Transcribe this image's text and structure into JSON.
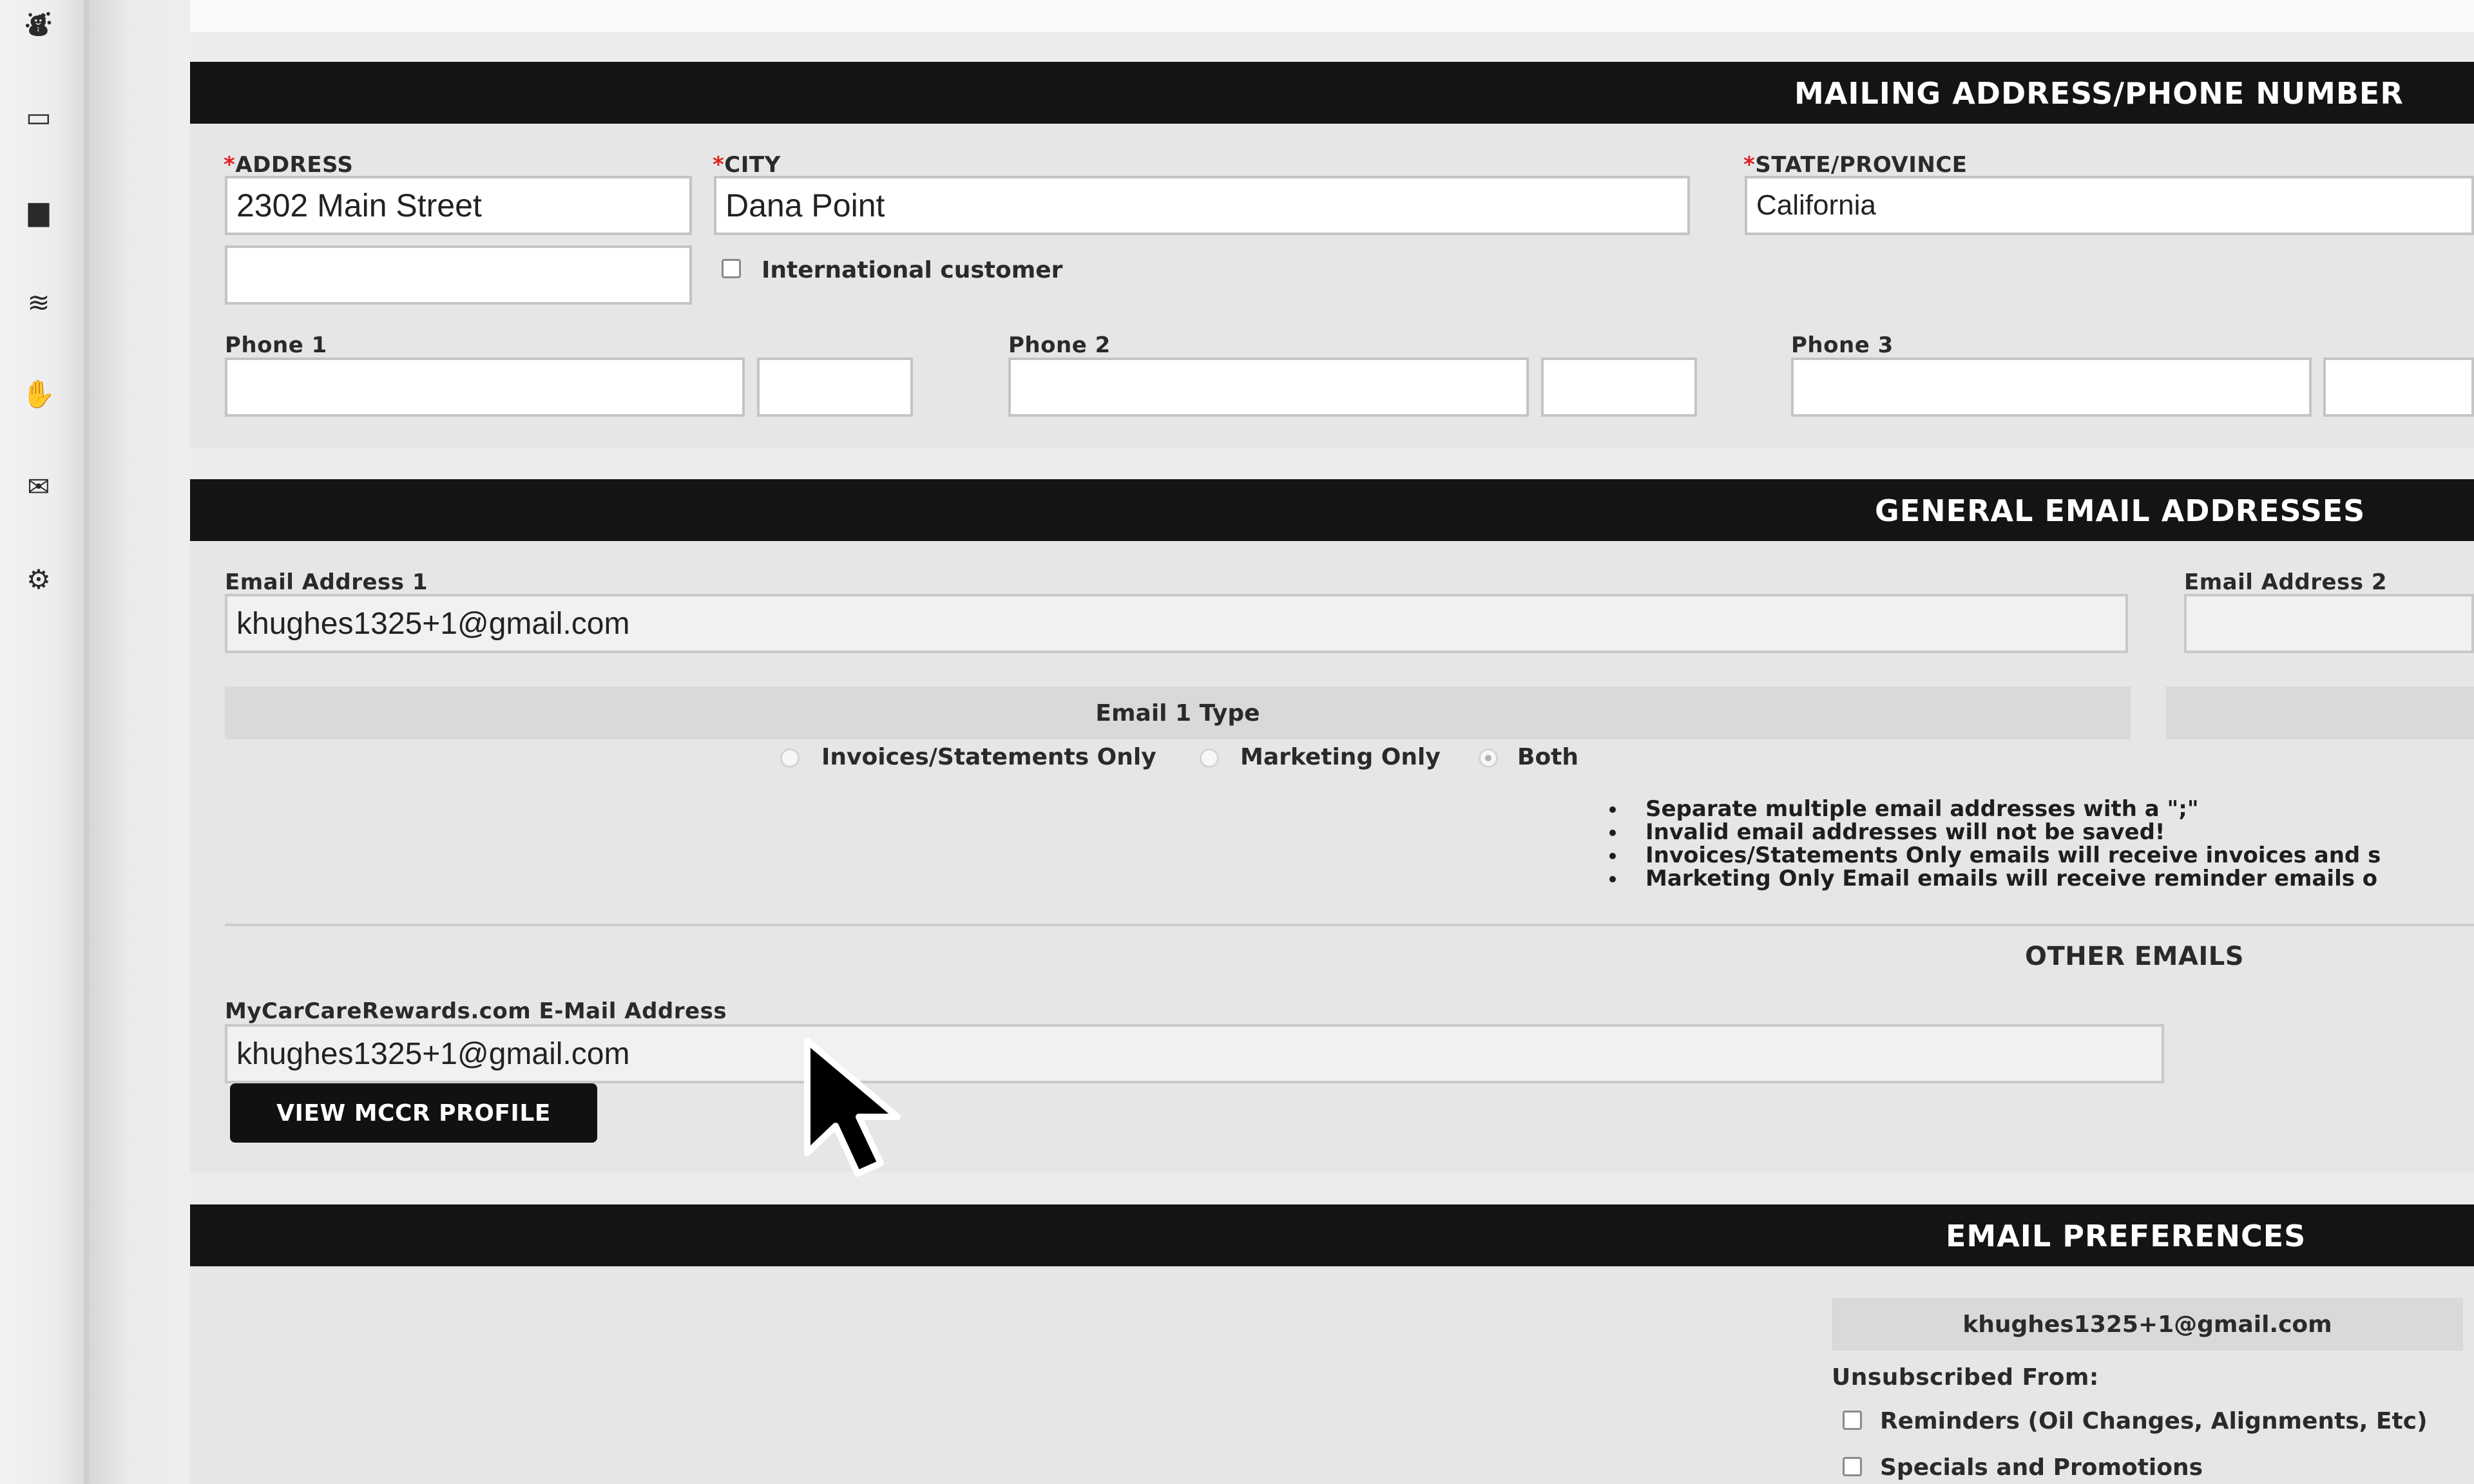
{
  "sidebar": {
    "items": [
      {
        "icon": "users-icon",
        "glyph": "⛇"
      },
      {
        "icon": "card-icon",
        "glyph": "▭"
      },
      {
        "icon": "document-icon",
        "glyph": "▆"
      },
      {
        "icon": "chart-icon",
        "glyph": "≋"
      },
      {
        "icon": "hand-icon",
        "glyph": "✋"
      },
      {
        "icon": "chat-icon",
        "glyph": "✉"
      },
      {
        "icon": "gear-icon",
        "glyph": "⚙"
      }
    ]
  },
  "mailing": {
    "title": "MAILING ADDRESS/PHONE NUMBER",
    "address_label": "ADDRESS",
    "address_value": "2302 Main Street",
    "address2_value": "",
    "city_label": "CITY",
    "city_value": "Dana Point",
    "intl_label": "International customer",
    "state_label": "STATE/PROVINCE",
    "state_value": "California",
    "phone1_label": "Phone 1",
    "phone2_label": "Phone 2",
    "phone3_label": "Phone 3"
  },
  "general_email": {
    "title": "GENERAL EMAIL ADDRESSES",
    "email1_label": "Email Address 1",
    "email1_value": "khughes1325+1@gmail.com",
    "email2_label": "Email Address 2",
    "email2_value": "",
    "type_label": "Email 1 Type",
    "options": [
      "Invoices/Statements Only",
      "Marketing Only",
      "Both"
    ],
    "selected_option": "Both",
    "notes": [
      "Separate multiple email addresses with a \";\"",
      "Invalid email addresses will not be saved!",
      "Invoices/Statements Only emails will receive invoices and s",
      "Marketing Only Email emails will receive reminder emails o"
    ],
    "other_emails_label": "OTHER EMAILS",
    "mccr_label": "MyCarCareRewards.com E-Mail Address",
    "mccr_value": "khughes1325+1@gmail.com",
    "view_button": "VIEW MCCR PROFILE"
  },
  "preferences": {
    "title": "EMAIL PREFERENCES",
    "email": "khughes1325+1@gmail.com",
    "unsub_label": "Unsubscribed From:",
    "items": [
      "Reminders (Oil Changes, Alignments, Etc)",
      "Specials and Promotions"
    ]
  },
  "colors": {
    "header_bg": "#141414",
    "panel_bg": "#e6e6e6",
    "required_marker": "#dd2222"
  }
}
